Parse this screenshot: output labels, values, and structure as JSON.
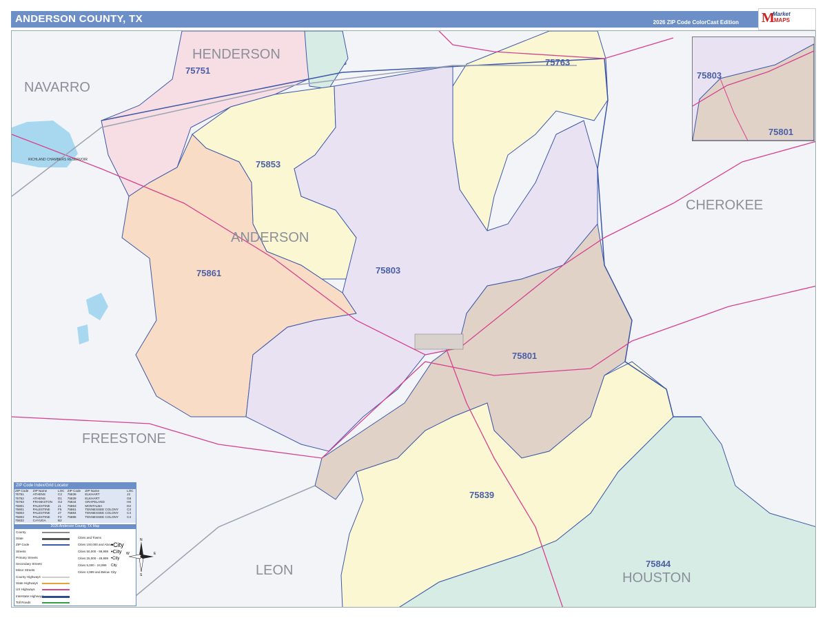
{
  "header": {
    "title": "ANDERSON COUNTY, TX",
    "edition": "2026 ZIP Code ColorCast Edition",
    "logo_text": "Market",
    "logo_text2": "MAPS"
  },
  "counties": {
    "henderson": "HENDERSON",
    "navarro": "NAVARRO",
    "cherokee": "CHEROKEE",
    "anderson": "ANDERSON",
    "freestone": "FREESTONE",
    "leon": "LEON",
    "houston": "HOUSTON"
  },
  "zip_labels": {
    "z75751": "75751",
    "z75763": "75763",
    "z75853": "75853",
    "z75861": "75861",
    "z75803": "75803",
    "z75801": "75801",
    "z75839": "75839",
    "z75844": "75844"
  },
  "water": {
    "reservoir": "RICHLAND CHAMBERS RESERVOIR"
  },
  "inset": {
    "z75803": "75803",
    "z75801": "75801"
  },
  "index": {
    "header": "ZIP Code Index/Grid Locator",
    "columns": [
      "ZIP Code",
      "ZIP Name",
      "LOC",
      "ZIP Code",
      "ZIP Name",
      "LOC"
    ],
    "rows": [
      [
        "75751",
        "ATHENS",
        "C2",
        "75839",
        "ELKHART",
        "J2"
      ],
      [
        "75752",
        "ATHENS",
        "D1",
        "75839",
        "ELKHART",
        "G6"
      ],
      [
        "75763",
        "FRANKSTON",
        "G2",
        "75844",
        "GRAPELAND",
        "H6"
      ],
      [
        "75801",
        "PALESTINE",
        "J1",
        "75853",
        "MONTALBA",
        "D2"
      ],
      [
        "75801",
        "PALESTINE",
        "F5",
        "75861",
        "TENNESSEE COLONY",
        "C3"
      ],
      [
        "75803",
        "PALESTINE",
        "J7",
        "75884",
        "TENNESSEE COLONY",
        "C4"
      ],
      [
        "75803",
        "PALESTINE",
        "F3",
        "75886",
        "TENNESSEE COLONY",
        "C4"
      ],
      [
        "75832",
        "CAYUGA",
        "B2",
        "",
        "",
        ""
      ]
    ]
  },
  "legend": {
    "title": "2026 Anderson County, TX Map",
    "items": [
      "County",
      "State",
      "ZIP Code",
      "Streets",
      "Primary Streets",
      "Secondary Streets",
      "Minor Streets",
      "County Highways",
      "State Highways",
      "US Highways",
      "Interstate Highways",
      "Toll Roads"
    ],
    "cities_header": "Cities and Towns",
    "cities": [
      {
        "label": "Cities 100,000 and Above",
        "symbol": "•City"
      },
      {
        "label": "Cities 50,000 - 99,999",
        "symbol": "•City"
      },
      {
        "label": "Cities 25,000 - 49,999",
        "symbol": "•City"
      },
      {
        "label": "Cities 5,000 - 24,999",
        "symbol": "City"
      },
      {
        "label": "Cities 4,999 and Below",
        "symbol": "City"
      }
    ]
  },
  "compass": {
    "n": "N",
    "s": "S",
    "e": "E",
    "w": "W"
  },
  "colors": {
    "header": "#6d8fc7",
    "zip_pink": "#f7dde4",
    "zip_yellow": "#fbf7d2",
    "zip_purple": "#e8e2f3",
    "zip_orange": "#f9dcc6",
    "zip_brown": "#e1d2c7",
    "zip_teal": "#d7ece5",
    "zip_border": "#3c57a8",
    "highway": "#d6418f",
    "interstate": "#9aa3b2"
  }
}
